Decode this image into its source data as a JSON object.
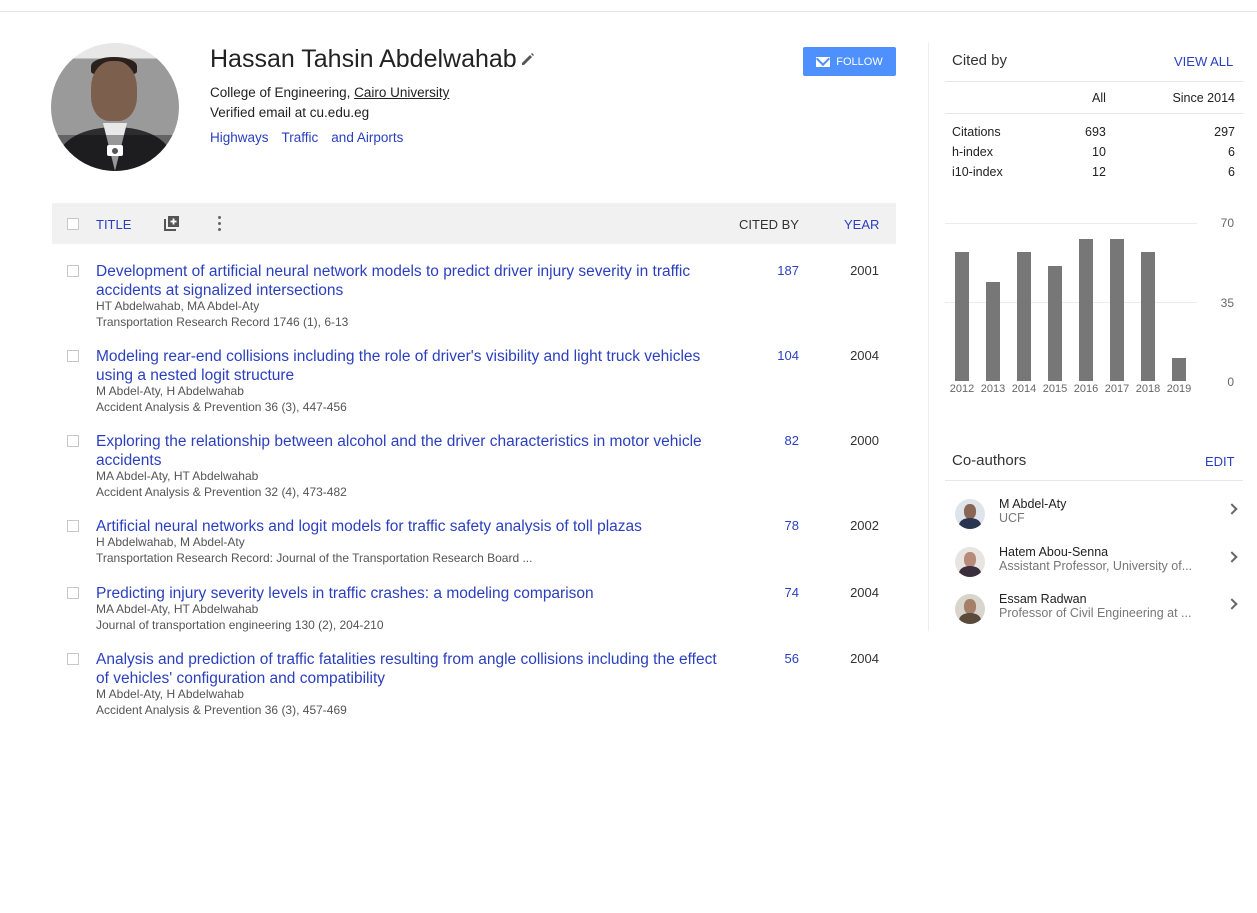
{
  "profile": {
    "name": "Hassan Tahsin Abdelwahab",
    "affiliation_prefix": "College of Engineering, ",
    "affiliation_link": "Cairo University",
    "email": "Verified email at cu.edu.eg",
    "interests": [
      "Highways",
      "Traffic",
      "and Airports"
    ],
    "follow_label": "FOLLOW"
  },
  "table": {
    "title_header": "TITLE",
    "cited_header": "CITED BY",
    "year_header": "YEAR",
    "rows": [
      {
        "title": "Development of artificial neural network models to predict driver injury severity in traffic accidents at signalized intersections",
        "authors": "HT Abdelwahab, MA Abdel-Aty",
        "venue": "Transportation Research Record 1746 (1), 6-13",
        "cited": "187",
        "year": "2001"
      },
      {
        "title": "Modeling rear-end collisions including the role of driver's visibility and light truck vehicles using a nested logit structure",
        "authors": "M Abdel-Aty, H Abdelwahab",
        "venue": "Accident Analysis & Prevention 36 (3), 447-456",
        "cited": "104",
        "year": "2004"
      },
      {
        "title": "Exploring the relationship between alcohol and the driver characteristics in motor vehicle accidents",
        "authors": "MA Abdel-Aty, HT Abdelwahab",
        "venue": "Accident Analysis & Prevention 32 (4), 473-482",
        "cited": "82",
        "year": "2000"
      },
      {
        "title": "Artificial neural networks and logit models for traffic safety analysis of toll plazas",
        "authors": "H Abdelwahab, M Abdel-Aty",
        "venue": "Transportation Research Record: Journal of the Transportation Research Board ...",
        "cited": "78",
        "year": "2002"
      },
      {
        "title": "Predicting injury severity levels in traffic crashes: a modeling comparison",
        "authors": "MA Abdel-Aty, HT Abdelwahab",
        "venue": "Journal of transportation engineering 130 (2), 204-210",
        "cited": "74",
        "year": "2004"
      },
      {
        "title": "Analysis and prediction of traffic fatalities resulting from angle collisions including the effect of vehicles' configuration and compatibility",
        "authors": "M Abdel-Aty, H Abdelwahab",
        "venue": "Accident Analysis & Prevention 36 (3), 457-469",
        "cited": "56",
        "year": "2004"
      }
    ]
  },
  "cited_by": {
    "title": "Cited by",
    "view_all": "VIEW ALL",
    "col_all": "All",
    "col_since": "Since 2014",
    "stats": [
      {
        "label": "Citations",
        "all": "693",
        "since": "297"
      },
      {
        "label": "h-index",
        "all": "10",
        "since": "6"
      },
      {
        "label": "i10-index",
        "all": "12",
        "since": "6"
      }
    ]
  },
  "chart_data": {
    "type": "bar",
    "categories": [
      "2012",
      "2013",
      "2014",
      "2015",
      "2016",
      "2017",
      "2018",
      "2019"
    ],
    "values": [
      57,
      44,
      57,
      51,
      63,
      63,
      57,
      10
    ],
    "ylim": [
      0,
      70
    ],
    "yticks": [
      "70",
      "35",
      "0"
    ],
    "bar_color": "#777777"
  },
  "coauthors": {
    "title": "Co-authors",
    "edit": "EDIT",
    "items": [
      {
        "name": "M Abdel-Aty",
        "sub": "UCF"
      },
      {
        "name": "Hatem Abou-Senna",
        "sub": "Assistant Professor, University of..."
      },
      {
        "name": "Essam Radwan",
        "sub": "Professor of Civil Engineering at ..."
      }
    ]
  },
  "colors": {
    "link": "#2a3fbf",
    "follow": "#4d90fe"
  }
}
